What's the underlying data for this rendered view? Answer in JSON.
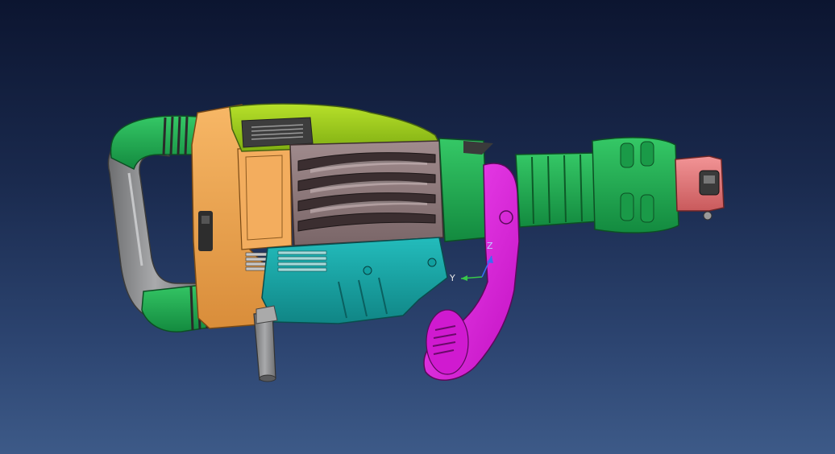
{
  "viewer": {
    "axis_labels": {
      "y": "Y",
      "z": "Z"
    }
  },
  "colors": {
    "background_top": "#0c1530",
    "background_bottom": "#3d5a88",
    "body_orange": "#f0a855",
    "top_cover_lime": "#9ccc1f",
    "handle_grip_green": "#2fb85c",
    "handle_frame_gray": "#8f9092",
    "grille_taupe": "#8f7a7c",
    "base_teal": "#18a7a7",
    "barrel_green": "#1eb055",
    "chuck_salmon": "#e5787a",
    "side_lever_magenta": "#e61be6",
    "y_axis_green": "#39c84a",
    "z_axis_blue": "#3b6ef2"
  },
  "icons": {
    "compass": "axis-triad-icon"
  }
}
